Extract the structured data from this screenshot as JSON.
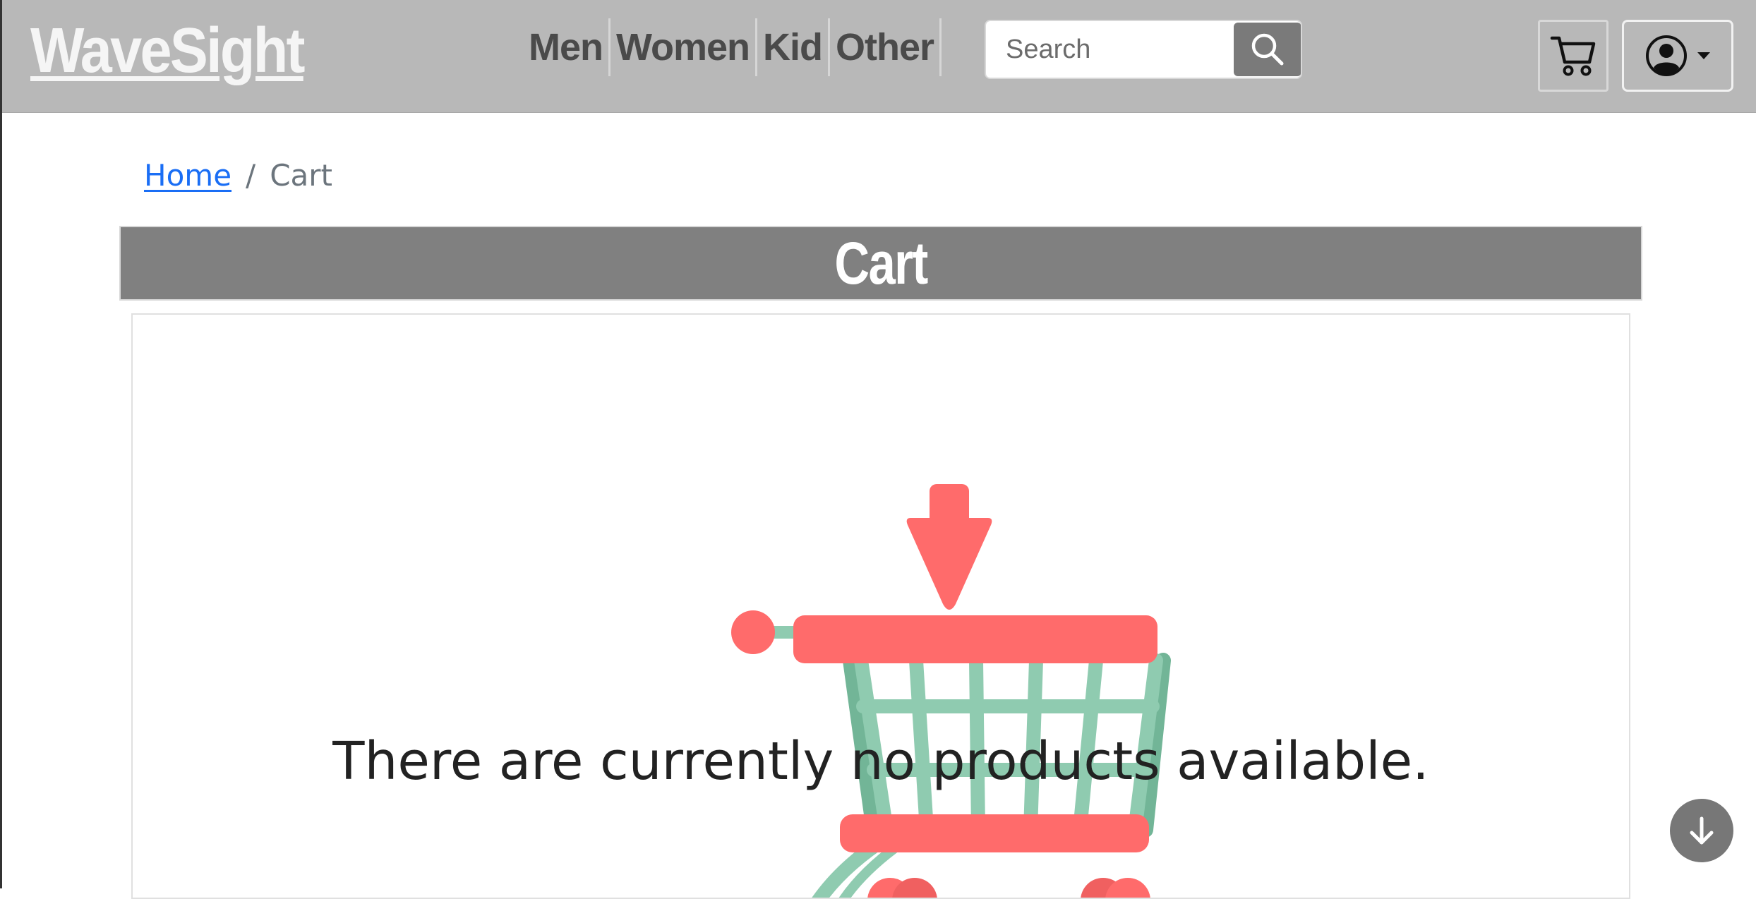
{
  "header": {
    "logo_text": "WaveSight",
    "nav": [
      {
        "label": "Men"
      },
      {
        "label": "Women"
      },
      {
        "label": "Kid"
      },
      {
        "label": "Other"
      }
    ],
    "search": {
      "placeholder": "Search",
      "value": "",
      "button_icon": "search-icon"
    },
    "cart_icon": "cart-icon",
    "user_icon": "person-circle-icon",
    "user_dropdown_icon": "caret-down-icon"
  },
  "breadcrumb": {
    "home_label": "Home",
    "separator": "/",
    "current_label": "Cart"
  },
  "cart": {
    "title": "Cart",
    "empty_message": "There are currently no products available.",
    "illustration": "empty-cart-illustration"
  },
  "scroll_button_icon": "arrow-down-icon",
  "colors": {
    "header_bg": "#b8b8b8",
    "logo": "#f5f5f5",
    "nav_text": "#4a4a4a",
    "link": "#1a6ef5",
    "cart_bar_bg": "#808080",
    "illustration_red": "#ff6b6b",
    "illustration_green": "#8fcbb0"
  }
}
